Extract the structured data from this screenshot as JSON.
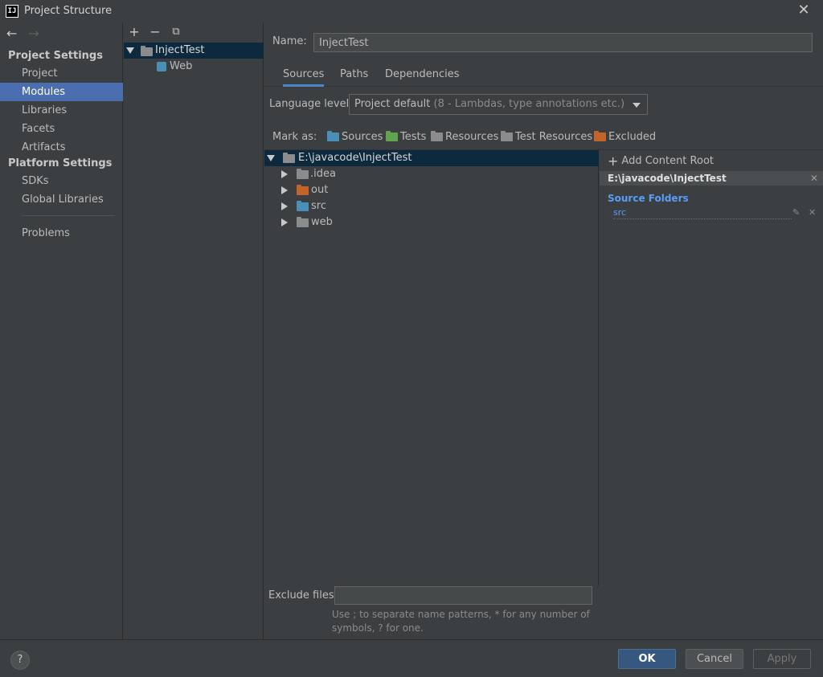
{
  "window": {
    "title": "Project Structure"
  },
  "nav": {
    "project_settings": "Project Settings",
    "platform_settings": "Platform Settings",
    "items": [
      {
        "label": "Project"
      },
      {
        "label": "Modules"
      },
      {
        "label": "Libraries"
      },
      {
        "label": "Facets"
      },
      {
        "label": "Artifacts"
      },
      {
        "label": "SDKs"
      },
      {
        "label": "Global Libraries"
      },
      {
        "label": "Problems"
      }
    ],
    "selected": "Modules"
  },
  "modules": {
    "toolbar": {
      "add": "+",
      "remove": "−",
      "copy": "⧉"
    },
    "tree": [
      {
        "label": "InjectTest"
      },
      {
        "label": "Web"
      }
    ]
  },
  "main": {
    "name_label": "Name:",
    "name_value": "InjectTest",
    "tabs": [
      {
        "label": "Sources"
      },
      {
        "label": "Paths"
      },
      {
        "label": "Dependencies"
      }
    ],
    "active_tab": "Sources",
    "language_level_label": "Language level:",
    "language_level_main": "Project default",
    "language_level_detail": "(8 - Lambdas, type annotations etc.)",
    "mark_as_label": "Mark as:",
    "mark_as": [
      {
        "label": "Sources",
        "color": "#4a8fb5"
      },
      {
        "label": "Tests",
        "color": "#62a350"
      },
      {
        "label": "Resources",
        "color": "#8c8c8c"
      },
      {
        "label": "Test Resources",
        "color": "#8c8c8c"
      },
      {
        "label": "Excluded",
        "color": "#c4632a"
      }
    ],
    "tree": [
      {
        "label": "E:\\javacode\\InjectTest"
      },
      {
        "label": ".idea"
      },
      {
        "label": "out"
      },
      {
        "label": "src"
      },
      {
        "label": "web"
      }
    ],
    "exclude_label": "Exclude files:",
    "exclude_value": "",
    "exclude_hint_1": "Use ; to separate name patterns, * for any number of",
    "exclude_hint_2": "symbols, ? for one."
  },
  "roots": {
    "add_label": "Add Content Root",
    "root_path": "E:\\javacode\\InjectTest",
    "source_folders_title": "Source Folders",
    "source_folders": [
      {
        "label": "src"
      }
    ]
  },
  "buttons": {
    "help": "?",
    "ok": "OK",
    "cancel": "Cancel",
    "apply": "Apply"
  },
  "colors": {
    "accent": "#4b6eaf",
    "link": "#589df6",
    "selection": "#0d293e"
  }
}
